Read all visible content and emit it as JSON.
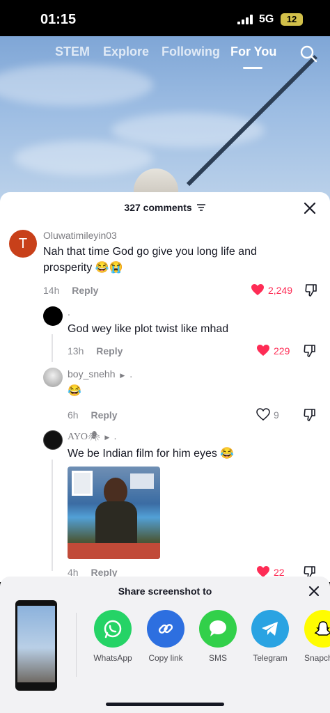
{
  "status_bar": {
    "time": "01:15",
    "network": "5G",
    "battery": "12"
  },
  "top_nav": {
    "tabs": [
      "STEM",
      "Explore",
      "Following",
      "For You"
    ],
    "active_tab": "For You"
  },
  "comments_panel": {
    "title": "327 comments",
    "comments": [
      {
        "avatar_letter": "T",
        "avatar_color": "#c8401a",
        "username": "Oluwatimileyin03",
        "text_line1": "Nah that time God go give you long life and",
        "text_line2": "prosperity 😂😭",
        "time": "14h",
        "reply_label": "Reply",
        "likes": "2,249"
      },
      {
        "username": ".",
        "text": "God wey like plot twist like mhad",
        "time": "13h",
        "reply_label": "Reply",
        "likes": "229"
      },
      {
        "username": "boy_snehh",
        "reply_to": ".",
        "text": "😂",
        "time": "6h",
        "reply_label": "Reply",
        "likes": "9"
      },
      {
        "username": "AYO🕷",
        "reply_to": ".",
        "text": "We be Indian film for him eyes 😂",
        "time": "4h",
        "reply_label": "Reply",
        "likes": "22"
      }
    ]
  },
  "share_panel": {
    "title": "Share screenshot to",
    "apps": [
      {
        "label": "WhatsApp",
        "color": "#25d366"
      },
      {
        "label": "Copy link",
        "color": "#2d6fe0"
      },
      {
        "label": "SMS",
        "color": "#32d04a"
      },
      {
        "label": "Telegram",
        "color": "#2aa3e2"
      },
      {
        "label": "Snapchat",
        "color": "#fffc00"
      }
    ]
  },
  "colors": {
    "like_red": "#fe2c55",
    "text_dark": "#161823",
    "text_gray": "#8a8b91"
  }
}
